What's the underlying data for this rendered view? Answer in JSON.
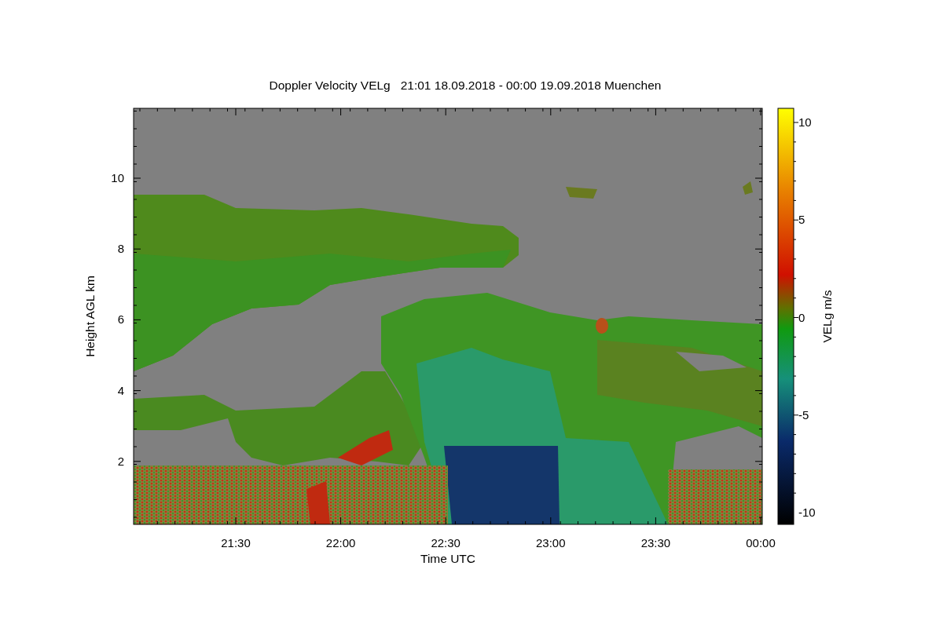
{
  "title": "Doppler Velocity VELg   21:01 18.09.2018 - 00:00 19.09.2018 Muenchen",
  "y_axis": {
    "label": "Height AGL km",
    "ticks": [
      "10",
      "8",
      "6",
      "4",
      "2"
    ]
  },
  "x_axis": {
    "label": "Time UTC",
    "ticks": [
      "21:30",
      "22:00",
      "22:30",
      "23:00",
      "23:30",
      "00:00"
    ]
  },
  "colorbar": {
    "label": "VELg m/s",
    "ticks": [
      "10",
      "5",
      "0",
      "-5",
      "-10"
    ]
  }
}
